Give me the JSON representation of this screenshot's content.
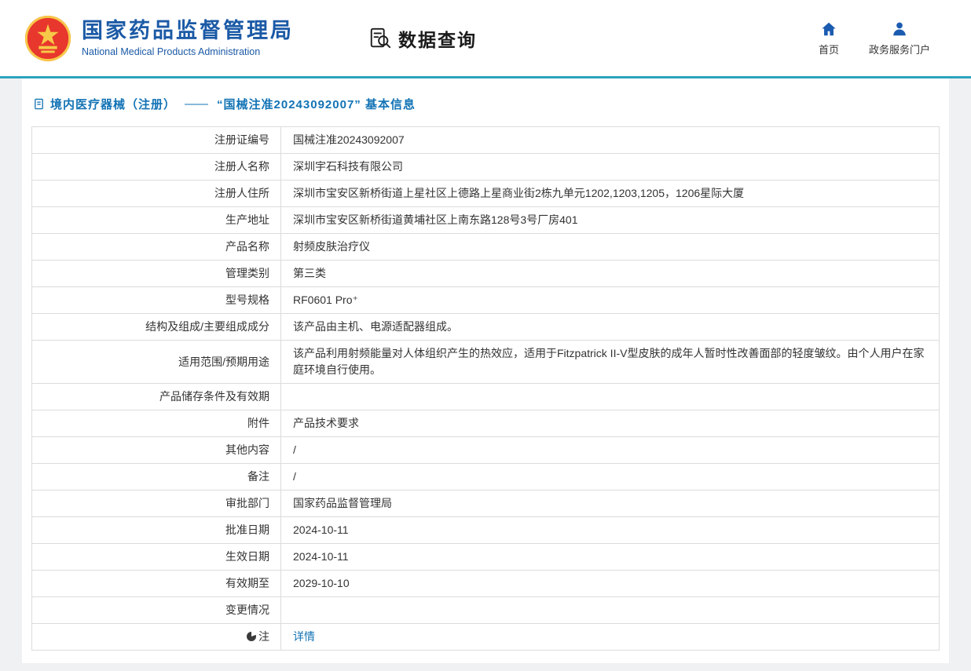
{
  "header": {
    "org_name_cn": "国家药品监督管理局",
    "org_name_en": "National Medical Products Administration",
    "app_title": "数据查询",
    "nav": [
      {
        "label": "首页",
        "icon": "home-icon"
      },
      {
        "label": "政务服务门户",
        "icon": "user-icon"
      }
    ]
  },
  "colors": {
    "brand_blue": "#1b5aa6",
    "divider_teal": "#2ba3bd",
    "link_blue": "#1273b5",
    "emblem_red": "#e8372c",
    "emblem_gold": "#f7c948"
  },
  "breadcrumb": {
    "icon": "document-icon",
    "category": "境内医疗器械（注册）",
    "separator": "——",
    "title": "“国械注准20243092007” 基本信息"
  },
  "table": {
    "rows": [
      {
        "label": "注册证编号",
        "value": "国械注准20243092007"
      },
      {
        "label": "注册人名称",
        "value": "深圳宇石科技有限公司"
      },
      {
        "label": "注册人住所",
        "value": "深圳市宝安区新桥街道上星社区上德路上星商业街2栋九单元1202,1203,1205，1206星际大厦"
      },
      {
        "label": "生产地址",
        "value": "深圳市宝安区新桥街道黄埔社区上南东路128号3号厂房401"
      },
      {
        "label": "产品名称",
        "value": "射频皮肤治疗仪"
      },
      {
        "label": "管理类别",
        "value": "第三类"
      },
      {
        "label": "型号规格",
        "value": "RF0601 Pro⁺"
      },
      {
        "label": "结构及组成/主要组成成分",
        "value": "该产品由主机、电源适配器组成。"
      },
      {
        "label": "适用范围/预期用途",
        "value": "该产品利用射频能量对人体组织产生的热效应，适用于Fitzpatrick II-V型皮肤的成年人暂时性改善面部的轻度皱纹。由个人用户在家庭环境自行使用。"
      },
      {
        "label": "产品储存条件及有效期",
        "value": ""
      },
      {
        "label": "附件",
        "value": "产品技术要求"
      },
      {
        "label": "其他内容",
        "value": "/"
      },
      {
        "label": "备注",
        "value": "/"
      },
      {
        "label": "审批部门",
        "value": "国家药品监督管理局"
      },
      {
        "label": "批准日期",
        "value": "2024-10-11"
      },
      {
        "label": "生效日期",
        "value": "2024-10-11"
      },
      {
        "label": "有效期至",
        "value": "2029-10-10"
      },
      {
        "label": "变更情况",
        "value": ""
      },
      {
        "label": "注",
        "value": "详情",
        "link": true,
        "icon": "note-circle-icon"
      }
    ]
  }
}
